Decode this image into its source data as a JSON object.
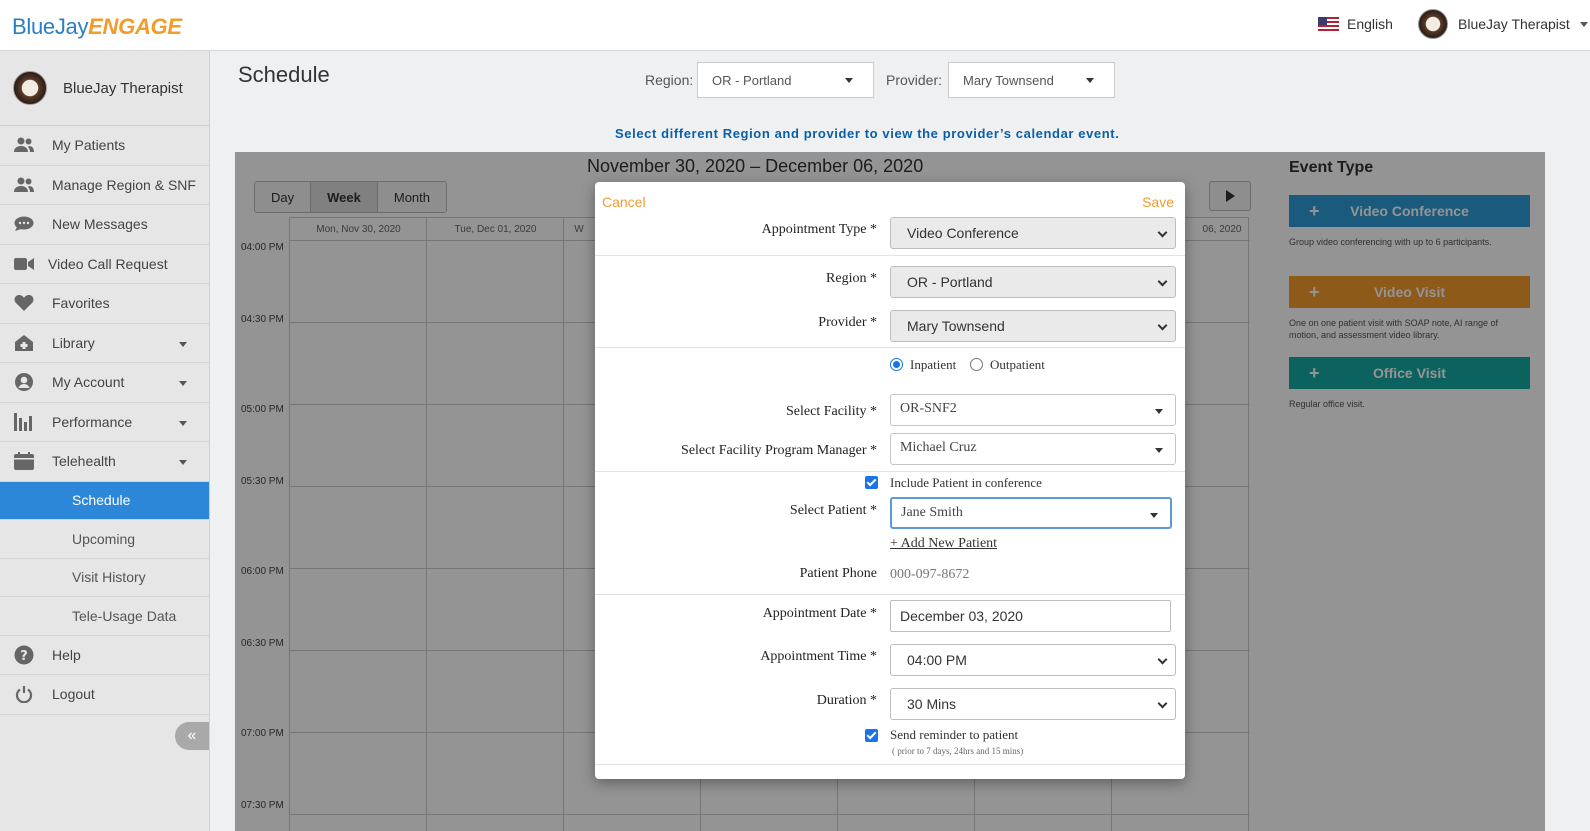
{
  "app": {
    "logo_main": "BlueJay",
    "logo_accent": "ENGAGE"
  },
  "header": {
    "language": "English",
    "user_name": "BlueJay Therapist"
  },
  "sidebar": {
    "user_name": "BlueJay Therapist",
    "items": [
      {
        "label": "My Patients",
        "icon": "patients-icon"
      },
      {
        "label": "Manage Region & SNF",
        "icon": "users-icon"
      },
      {
        "label": "New Messages",
        "icon": "chat-icon"
      },
      {
        "label": "Video Call Request",
        "icon": "video-icon"
      },
      {
        "label": "Favorites",
        "icon": "heart-icon"
      },
      {
        "label": "Library",
        "icon": "library-icon"
      },
      {
        "label": "My Account",
        "icon": "account-icon"
      },
      {
        "label": "Performance",
        "icon": "bar-chart-icon"
      },
      {
        "label": "Telehealth",
        "icon": "calendar-icon"
      }
    ],
    "subitems": [
      "Schedule",
      "Upcoming",
      "Visit History",
      "Tele-Usage Data"
    ],
    "footer": [
      {
        "label": "Help",
        "icon": "help-icon"
      },
      {
        "label": "Logout",
        "icon": "power-icon"
      }
    ],
    "collapse": "«"
  },
  "page": {
    "title": "Schedule",
    "region_label": "Region:",
    "region_value": "OR - Portland",
    "provider_label": "Provider:",
    "provider_value": "Mary Townsend",
    "hint": "Select different Region and provider to view the provider’s calendar event."
  },
  "calendar": {
    "range": "November 30, 2020 – December 06, 2020",
    "views": [
      "Day",
      "Week",
      "Month"
    ],
    "active_view": "Week",
    "columns": [
      "Mon, Nov 30, 2020",
      "Tue, Dec 01, 2020",
      "W",
      "",
      "",
      "",
      "06, 2020"
    ],
    "times": [
      "04:00 PM",
      "04:30 PM",
      "05:00 PM",
      "05:30 PM",
      "06:00 PM",
      "06:30 PM",
      "07:00 PM",
      "07:30 PM"
    ]
  },
  "event_type": {
    "title": "Event Type",
    "items": [
      {
        "label": "Video Conference",
        "desc": "Group video conferencing with up to 6 participants.",
        "color": "#2d9bd6"
      },
      {
        "label": "Video Visit",
        "desc": "One on one patient visit with SOAP note, AI range of motion, and assessment video library.",
        "color": "#f39c2b"
      },
      {
        "label": "Office Visit",
        "desc": "Regular office visit.",
        "color": "#15a9a3"
      }
    ]
  },
  "modal": {
    "cancel": "Cancel",
    "save": "Save",
    "appointment_type_label": "Appointment Type *",
    "appointment_type": "Video Conference",
    "region_label": "Region *",
    "region": "OR - Portland",
    "provider_label": "Provider *",
    "provider": "Mary Townsend",
    "inpatient": "Inpatient",
    "outpatient": "Outpatient",
    "facility_label": "Select Facility *",
    "facility": "OR-SNF2",
    "manager_label": "Select Facility Program Manager *",
    "manager": "Michael Cruz",
    "include_patient": "Include Patient in conference",
    "patient_label": "Select Patient *",
    "patient": "Jane Smith",
    "add_patient": "+ Add New Patient",
    "phone_label": "Patient Phone",
    "phone": "000-097-8672",
    "date_label": "Appointment Date *",
    "date": "December 03, 2020",
    "time_label": "Appointment Time *",
    "time": "04:00 PM",
    "duration_label": "Duration *",
    "duration": "30 Mins",
    "reminder": "Send reminder to patient",
    "reminder_note": "( prior to 7 days, 24hrs and 15 mins)"
  }
}
